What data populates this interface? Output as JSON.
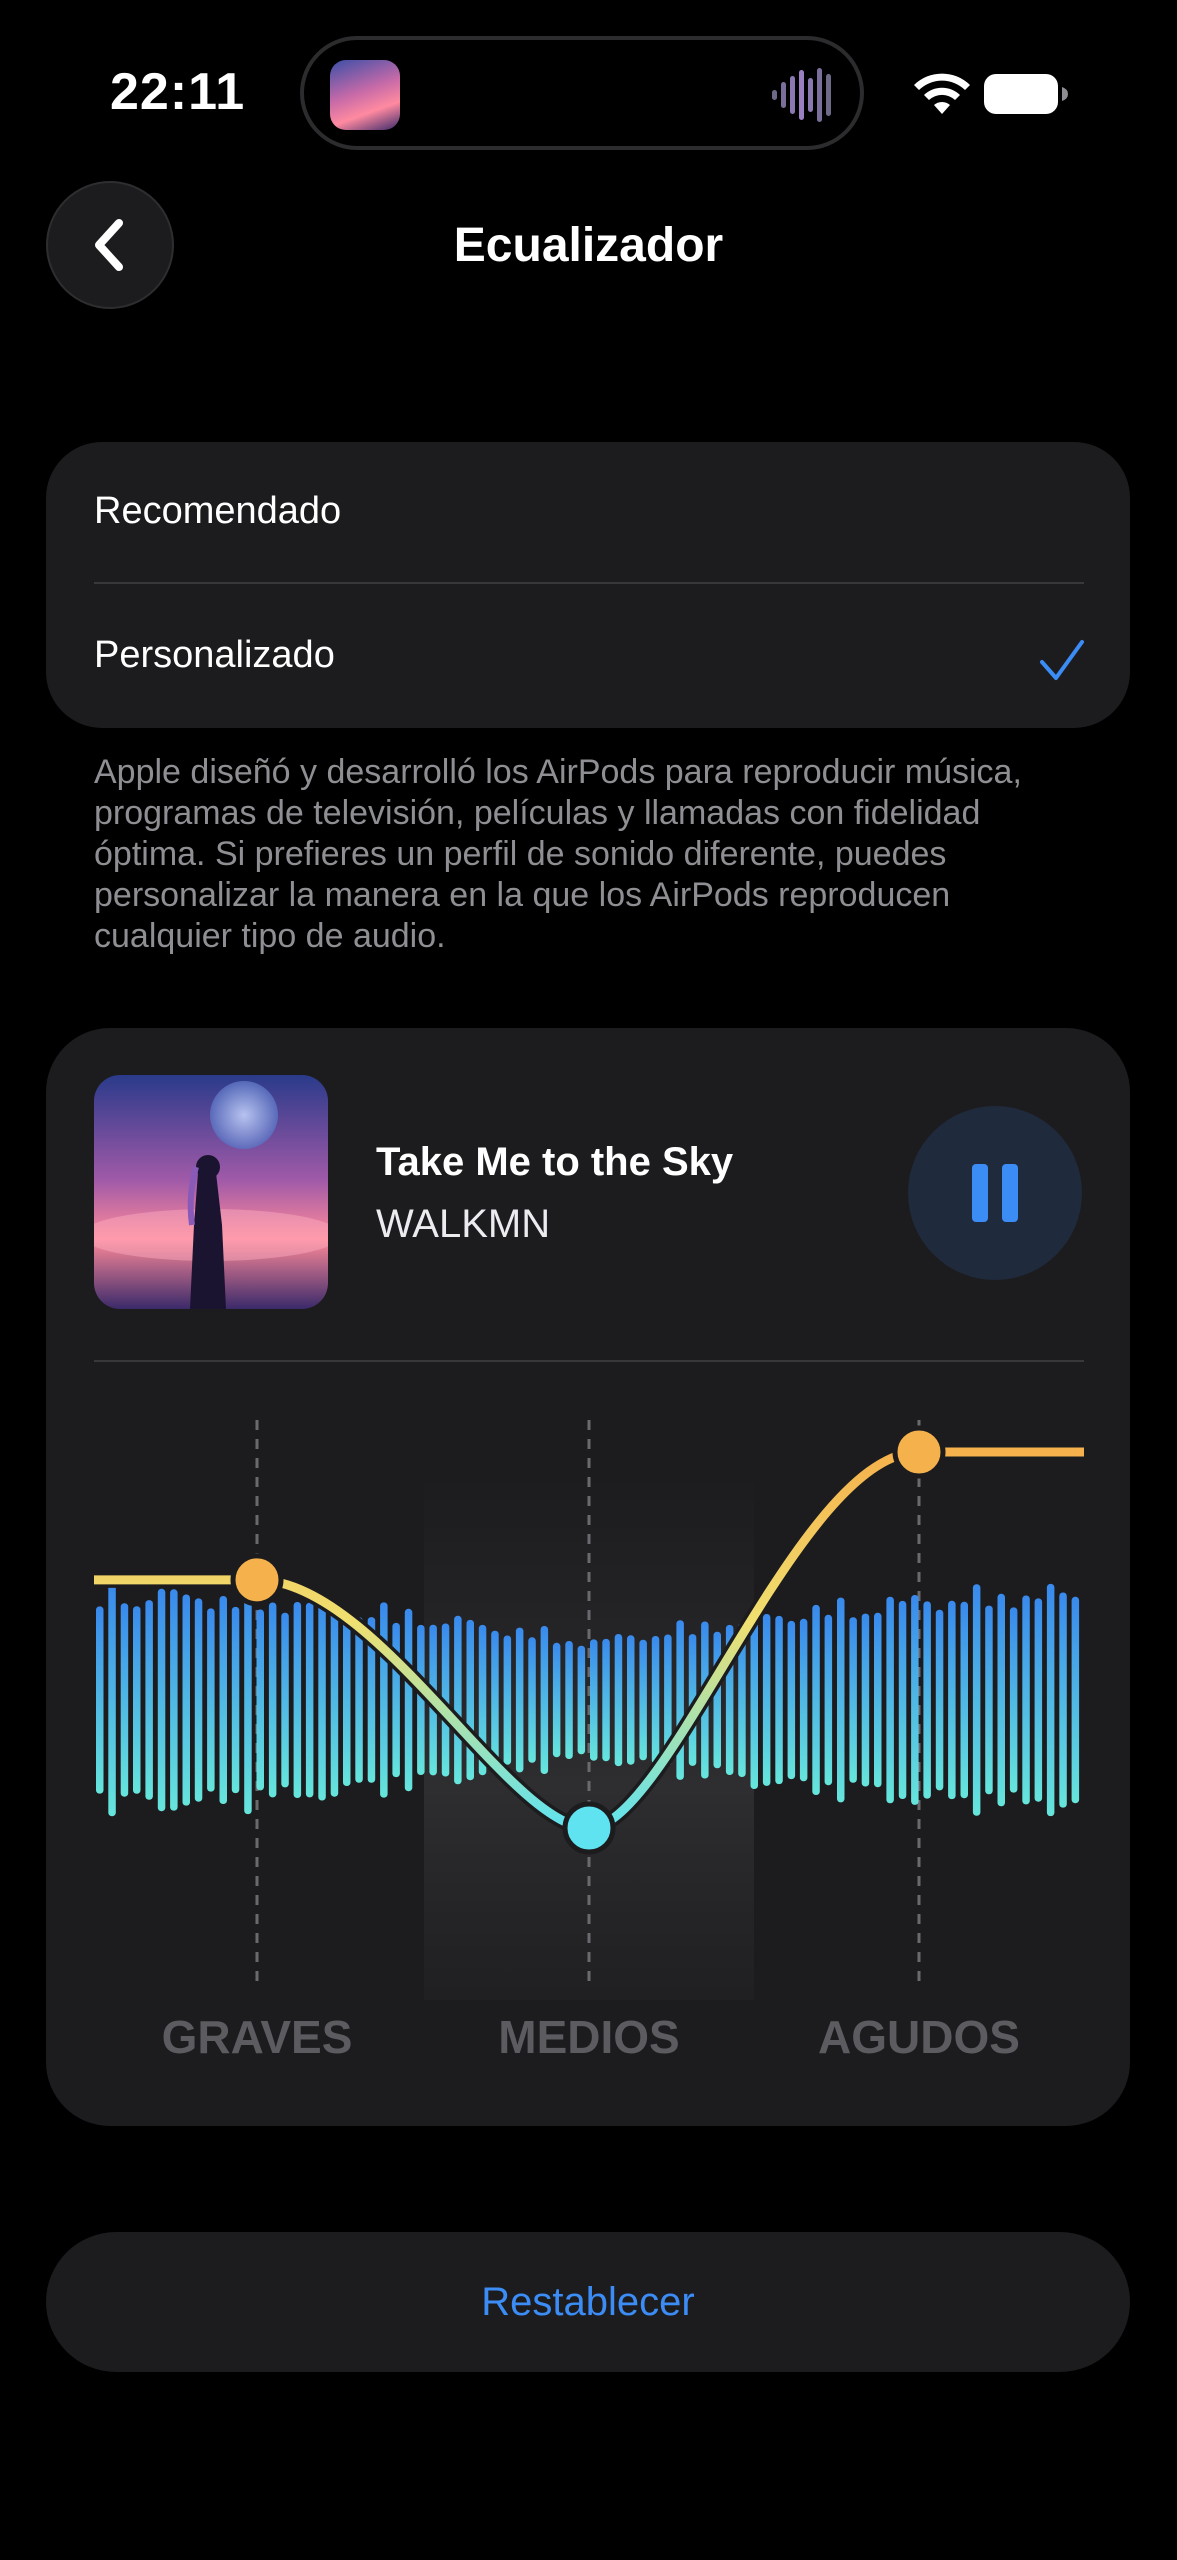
{
  "status_bar": {
    "time": "22:11"
  },
  "header": {
    "title": "Ecualizador",
    "back_icon": "chevron-left-icon"
  },
  "options": {
    "items": [
      {
        "label": "Recomendado",
        "selected": false
      },
      {
        "label": "Personalizado",
        "selected": true
      }
    ],
    "check_icon": "checkmark-icon"
  },
  "description": "Apple diseñó y desarrolló los AirPods para reproducir música, programas de televisión, películas y llamadas con fidelidad óptima. Si prefieres un perfil de sonido diferente, puedes personalizar la manera en la que los AirPods reproducen cualquier tipo de audio.",
  "player": {
    "title": "Take Me to the Sky",
    "artist": "WALKMN",
    "pause_icon": "pause-icon"
  },
  "equalizer": {
    "bands": [
      "GRAVES",
      "MEDIOS",
      "AGUDOS"
    ],
    "levels": {
      "GRAVES": 0.66,
      "MEDIOS": 0.0,
      "AGUDOS": 1.0
    }
  },
  "reset": {
    "label": "Restablecer"
  },
  "colors": {
    "accent": "#3b8cf5",
    "eq_high": "#f5b14c",
    "eq_low": "#5fe3f0",
    "wave_blue": "#3a8ff7",
    "wave_cyan": "#6af0e6",
    "card_bg": "#1c1c1e"
  }
}
